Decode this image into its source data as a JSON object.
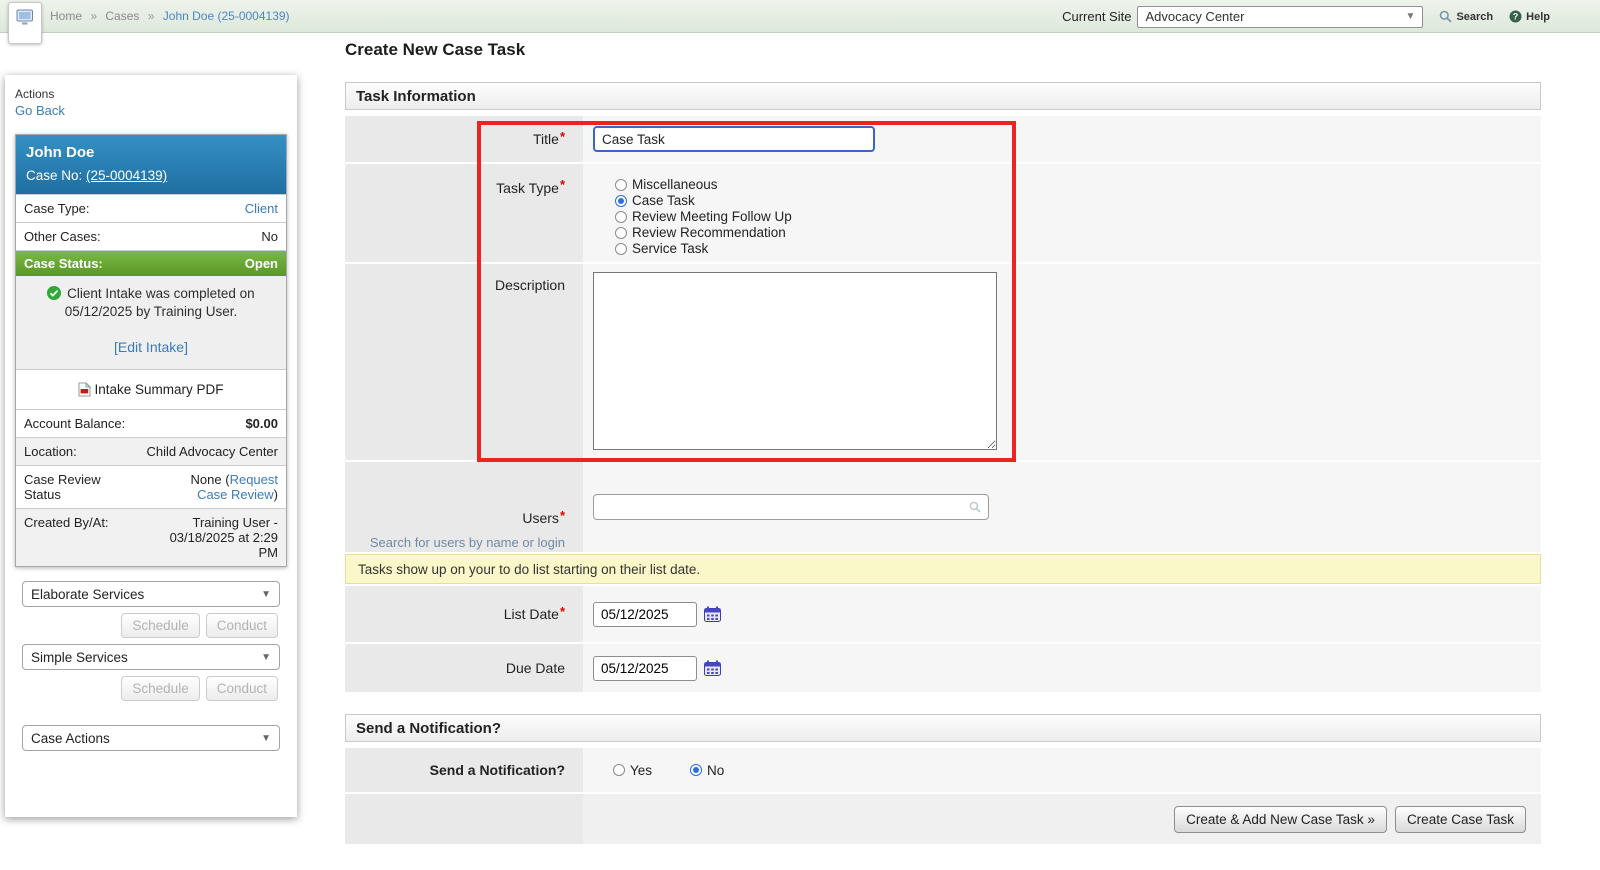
{
  "colors": {
    "accent_blue": "#3a7bbd",
    "header_blue": "#2f84b5",
    "status_green": "#6aa832",
    "notice_yellow": "#faf7c8",
    "annotation_red": "#e8261d",
    "focus_blue": "#3a66cc"
  },
  "icons": {
    "app_icon": "monitor",
    "search_icon": "magnifier",
    "help_icon": "question-circle",
    "chevron_down_icon": "▼",
    "check_icon": "✓",
    "pdf_icon": "pdf-page",
    "calendar_icon": "calendar-grid"
  },
  "topbar": {
    "breadcrumb": {
      "items": [
        "Home",
        "Cases"
      ],
      "current": "John Doe (25-0004139)",
      "separator": "»"
    },
    "current_site_label": "Current Site",
    "current_site_value": "Advocacy Center",
    "search_label": "Search",
    "help_label": "Help"
  },
  "sidebar": {
    "actions_label": "Actions",
    "go_back_label": "Go Back",
    "case_card": {
      "name": "John Doe",
      "case_no_label": "Case No:",
      "case_no_link": "(25-0004139)",
      "case_type_label": "Case Type:",
      "case_type_value": "Client",
      "other_cases_label": "Other Cases:",
      "other_cases_value": "No",
      "case_status_label": "Case Status:",
      "case_status_value": "Open",
      "intake_message": "Client Intake was completed on 05/12/2025 by Training User.",
      "edit_intake_label": "[Edit Intake]",
      "intake_pdf_label": "Intake Summary PDF",
      "account_balance_label": "Account Balance:",
      "account_balance_value": "$0.00",
      "location_label": "Location:",
      "location_value": "Child Advocacy Center",
      "case_review_label": "Case Review Status",
      "case_review_value_prefix": "None (",
      "case_review_link": "Request Case Review",
      "case_review_value_suffix": ")",
      "created_label": "Created By/At:",
      "created_value": "Training User - 03/18/2025 at 2:29 PM"
    },
    "services": {
      "elaborate_label": "Elaborate Services",
      "simple_label": "Simple Services",
      "schedule_label": "Schedule",
      "conduct_label": "Conduct",
      "case_actions_label": "Case Actions"
    }
  },
  "main": {
    "page_title": "Create New Case Task",
    "required_marker": "*",
    "task_information": {
      "header": "Task Information",
      "title": {
        "label": "Title",
        "value": "Case Task"
      },
      "task_type": {
        "label": "Task Type",
        "options": [
          "Miscellaneous",
          "Case Task",
          "Review Meeting Follow Up",
          "Review Recommendation",
          "Service Task"
        ],
        "selected": "Case Task"
      },
      "description": {
        "label": "Description",
        "value": ""
      },
      "users": {
        "label": "Users",
        "sublabel": "Search for users by name or login",
        "value": ""
      },
      "notice": "Tasks show up on your to do list starting on their list date.",
      "list_date": {
        "label": "List Date",
        "value": "05/12/2025"
      },
      "due_date": {
        "label": "Due Date",
        "value": "05/12/2025"
      }
    },
    "notification": {
      "header": "Send a Notification?",
      "label": "Send a Notification?",
      "yes_label": "Yes",
      "no_label": "No",
      "selected": "No"
    },
    "buttons": {
      "create_add_label": "Create & Add New Case Task »",
      "create_label": "Create Case Task"
    }
  }
}
